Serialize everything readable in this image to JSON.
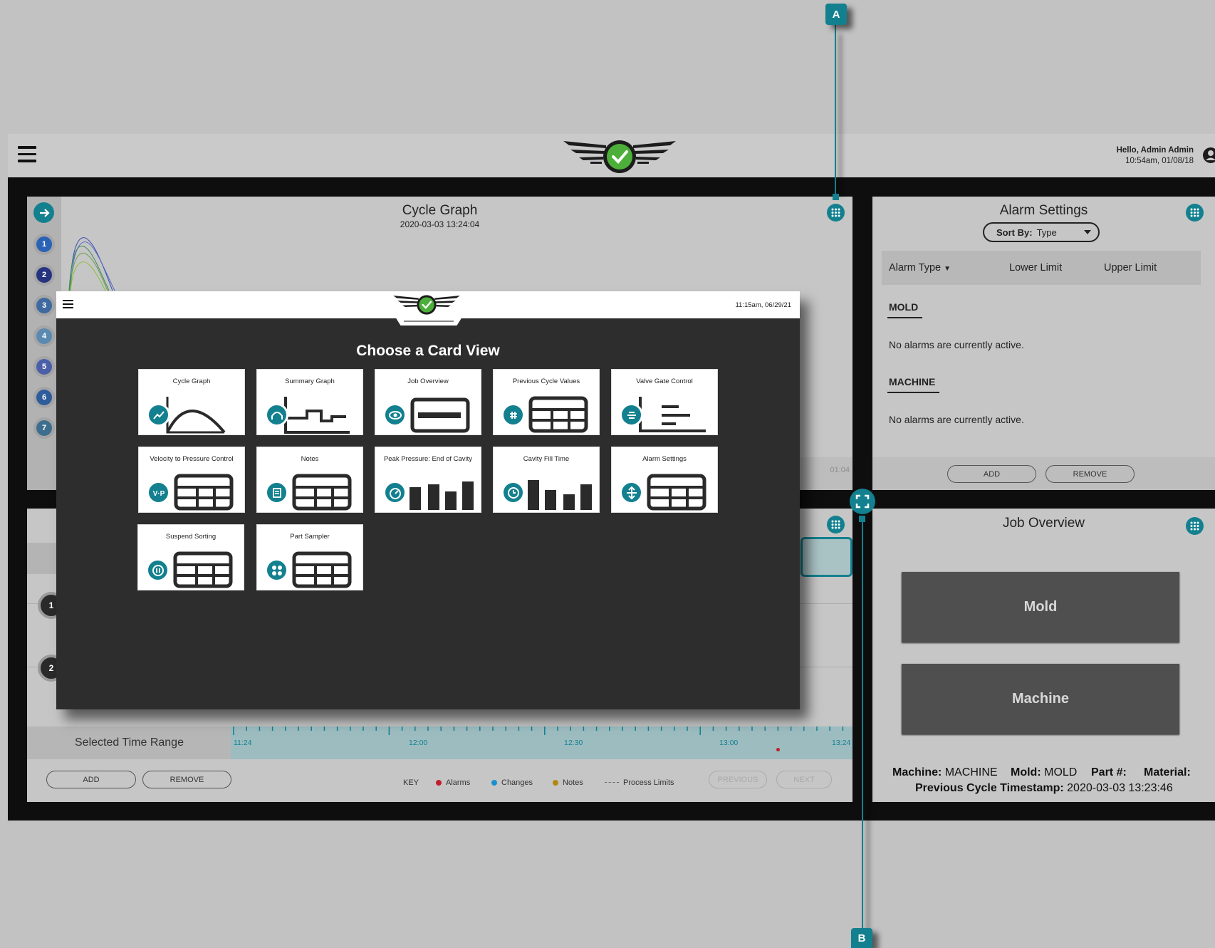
{
  "app": {
    "greeting": "Hello, Admin Admin",
    "datetime": "10:54am, 01/08/18"
  },
  "cycle_graph": {
    "title": "Cycle Graph",
    "subtitle": "2020-03-03   13:24:04",
    "cycles": [
      "1",
      "2",
      "3",
      "4",
      "5",
      "6",
      "7"
    ],
    "cycle_colors": [
      "#2a63b5",
      "#26337f",
      "#3f6aa0",
      "#5b8ab0",
      "#4b5fa8",
      "#2f5c9a",
      "#3e6e8e"
    ],
    "axis_time": "01:04"
  },
  "alarm_settings": {
    "title": "Alarm Settings",
    "sort_label": "Sort By:",
    "sort_value": "Type",
    "columns": [
      "Alarm Type",
      "Lower Limit",
      "Upper Limit"
    ],
    "sections": [
      {
        "name": "MOLD",
        "message": "No alarms are currently active."
      },
      {
        "name": "MACHINE",
        "message": "No alarms are currently active."
      }
    ],
    "add_label": "ADD",
    "remove_label": "REMOVE"
  },
  "timeline": {
    "rows": [
      "1",
      "2"
    ],
    "range_label": "Selected Time Range",
    "ticks": [
      "11:24",
      "12:00",
      "12:30",
      "13:00",
      "13:24"
    ],
    "add_label": "ADD",
    "remove_label": "REMOVE",
    "key_label": "KEY",
    "legend": [
      {
        "label": "Alarms",
        "color": "#c0202a"
      },
      {
        "label": "Changes",
        "color": "#1a8fd0"
      },
      {
        "label": "Notes",
        "color": "#b08a10"
      },
      {
        "label": "Process Limits",
        "color": "#666666"
      }
    ],
    "previous_label": "PREVIOUS",
    "next_label": "NEXT"
  },
  "job_overview": {
    "title": "Job Overview",
    "mold_button": "Mold",
    "machine_button": "Machine",
    "machine_key": "Machine:",
    "machine_value": "MACHINE",
    "mold_key": "Mold:",
    "mold_value": "MOLD",
    "part_key": "Part #:",
    "material_key": "Material:",
    "timestamp_key": "Previous Cycle Timestamp:",
    "timestamp_value": "2020-03-03   13:23:46"
  },
  "modal": {
    "datetime": "11:15am, 06/29/21",
    "title": "Choose a Card View",
    "tiles": [
      {
        "label": "Cycle Graph",
        "icon": "cycle-graph-icon"
      },
      {
        "label": "Summary Graph",
        "icon": "summary-graph-icon"
      },
      {
        "label": "Job Overview",
        "icon": "eye-icon"
      },
      {
        "label": "Previous Cycle Values",
        "icon": "history-hash-icon"
      },
      {
        "label": "Valve Gate Control",
        "icon": "valve-gate-icon"
      },
      {
        "label": "Velocity to Pressure Control",
        "icon": "vp-icon"
      },
      {
        "label": "Notes",
        "icon": "notes-icon"
      },
      {
        "label": "Peak Pressure: End of Cavity",
        "icon": "gauge-icon"
      },
      {
        "label": "Cavity Fill Time",
        "icon": "clock-icon"
      },
      {
        "label": "Alarm Settings",
        "icon": "limits-icon"
      },
      {
        "label": "Suspend Sorting",
        "icon": "pause-icon"
      },
      {
        "label": "Part Sampler",
        "icon": "sampler-icon"
      }
    ]
  },
  "callouts": {
    "a": "A",
    "b": "B"
  },
  "colors": {
    "accent": "#13808f",
    "status_ok": "#4caf3a"
  }
}
